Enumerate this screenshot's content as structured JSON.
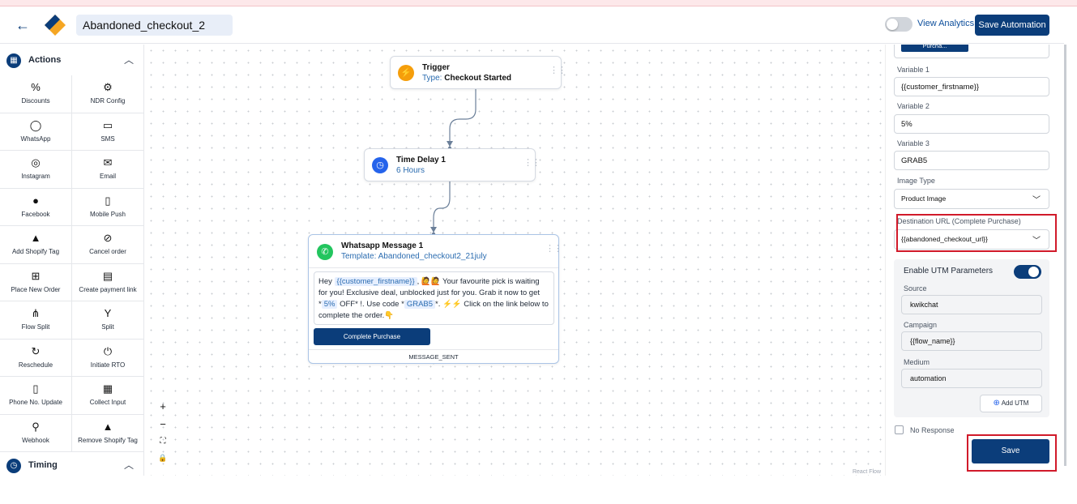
{
  "header": {
    "back_icon": "arrow-left-icon",
    "flow_name": "Abandoned_checkout_2",
    "view_analytics": "View Analytics",
    "save_automation": "Save Automation"
  },
  "sidebar": {
    "actions_label": "Actions",
    "timing_label": "Timing",
    "items": [
      {
        "label": "Discounts",
        "icon": "%"
      },
      {
        "label": "NDR Config",
        "icon": "⚙"
      },
      {
        "label": "WhatsApp",
        "icon": "◯"
      },
      {
        "label": "SMS",
        "icon": "▭"
      },
      {
        "label": "Instagram",
        "icon": "◎"
      },
      {
        "label": "Email",
        "icon": "✉"
      },
      {
        "label": "Facebook",
        "icon": "●"
      },
      {
        "label": "Mobile Push",
        "icon": "▯"
      },
      {
        "label": "Add Shopify Tag",
        "icon": "▲"
      },
      {
        "label": "Cancel order",
        "icon": "⊘"
      },
      {
        "label": "Place New Order",
        "icon": "⊞"
      },
      {
        "label": "Create payment link",
        "icon": "▤"
      },
      {
        "label": "Flow Split",
        "icon": "⋔"
      },
      {
        "label": "Split",
        "icon": "Y"
      },
      {
        "label": "Reschedule",
        "icon": "↻"
      },
      {
        "label": "Initiate RTO",
        "icon": "⏻"
      },
      {
        "label": "Phone No. Update",
        "icon": "▯"
      },
      {
        "label": "Collect Input",
        "icon": "▦"
      },
      {
        "label": "Webhook",
        "icon": "⚲"
      },
      {
        "label": "Remove Shopify Tag",
        "icon": "▲"
      }
    ]
  },
  "canvas": {
    "react_flow": "React Flow",
    "controls": {
      "zoom_in": "+",
      "zoom_out": "−",
      "fit": "⛶",
      "lock": "🔒"
    },
    "trigger": {
      "title": "Trigger",
      "type_prefix": "Type:",
      "type_value": "Checkout Started"
    },
    "delay": {
      "title": "Time Delay 1",
      "duration": "6 Hours"
    },
    "whatsapp": {
      "title": "Whatsapp Message 1",
      "template": "Template: Abandoned_checkout2_21july",
      "msg_1": "Hey ",
      "var_1": "{{customer_firstname}}",
      "msg_2": ", 🙋🙋 Your favourite pick is waiting for you! Exclusive deal, unblocked just for you. Grab it now to get *",
      "var_2": "5%",
      "msg_3": " OFF* !. Use code *",
      "var_3": "GRAB5",
      "msg_4": "*. ⚡⚡ Click on the link below to complete the order.👇",
      "button": "Complete Purchase",
      "status": "MESSAGE_SENT"
    }
  },
  "panel": {
    "top_button": "Purcha...",
    "var1_label": "Variable 1",
    "var1_value": "{{customer_firstname}}",
    "var2_label": "Variable 2",
    "var2_value": "5%",
    "var3_label": "Variable 3",
    "var3_value": "GRAB5",
    "image_type_label": "Image Type",
    "image_type_value": "Product Image",
    "dest_label": "Destination URL (Complete Purchase)",
    "dest_value": "{{abandoned_checkout_url}}",
    "utm_label": "Enable UTM Parameters",
    "utm_enabled": true,
    "source_label": "Source",
    "source_value": "kwikchat",
    "campaign_label": "Campaign",
    "campaign_value": "{{flow_name}}",
    "medium_label": "Medium",
    "medium_value": "automation",
    "add_utm": "Add UTM",
    "no_response": "No Response",
    "save": "Save"
  },
  "colors": {
    "primary": "#0b3d7a",
    "highlight": "#d11a2a",
    "trigger": "#f59e0b",
    "delay": "#2563eb",
    "whatsapp": "#22c55e"
  }
}
